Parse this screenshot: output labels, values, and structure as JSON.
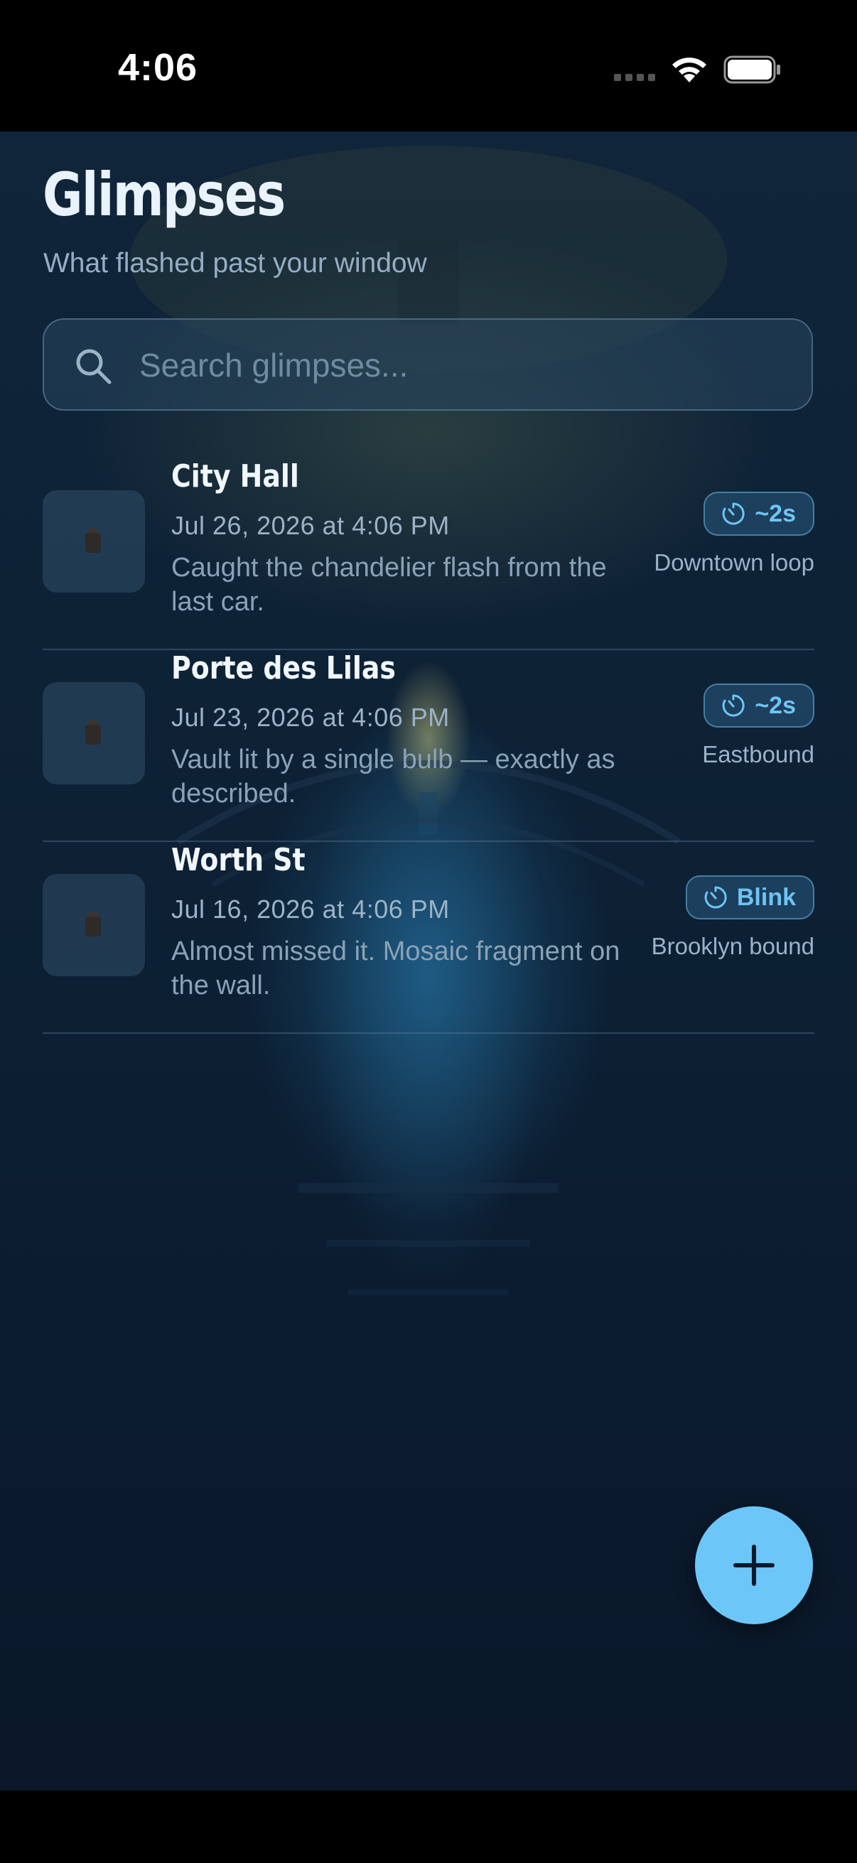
{
  "status_bar": {
    "time": "4:06",
    "icons": [
      "cellular-dots-icon",
      "wifi-icon",
      "battery-icon"
    ]
  },
  "header": {
    "title": "Glimpses",
    "subtitle": "What flashed past your window"
  },
  "search": {
    "placeholder": "Search glimpses...",
    "value": ""
  },
  "glimpses": [
    {
      "title": "City Hall",
      "date": "Jul 26, 2026 at 4:06 PM",
      "note": "Caught the chandelier flash from the last car.",
      "duration": "~2s",
      "line": "Downtown loop"
    },
    {
      "title": "Porte des Lilas",
      "date": "Jul 23, 2026 at 4:06 PM",
      "note": "Vault lit by a single bulb — exactly as described.",
      "duration": "~2s",
      "line": "Eastbound"
    },
    {
      "title": "Worth St",
      "date": "Jul 16, 2026 at 4:06 PM",
      "note": "Almost missed it. Mosaic fragment on the wall.",
      "duration": "Blink",
      "line": "Brooklyn bound"
    }
  ],
  "fab": {
    "icon": "plus-icon"
  },
  "colors": {
    "accent": "#6cc6f8",
    "badge_text": "#6fc4f3",
    "background": "#0c1f33",
    "title": "#eaf3fb",
    "muted": "#9cb3c6"
  }
}
